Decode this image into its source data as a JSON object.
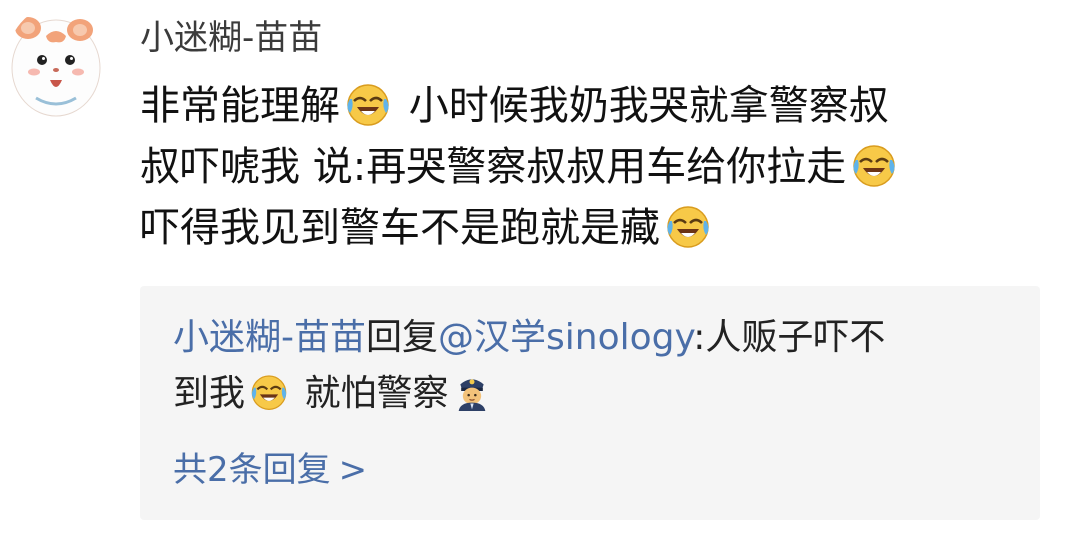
{
  "post": {
    "username": "小迷糊-苗苗",
    "avatar_icon": "hamster-avatar",
    "comment": {
      "line1_a": "非常能理解",
      "line1_b": "小时候我奶我哭就拿警察叔",
      "line2_a": "叔吓唬我 说:再哭警察叔叔用车给你拉走",
      "line3_a": "吓得我见到警车不是跑就是藏"
    },
    "emoji_icon": "laughing-crying-emoji"
  },
  "reply": {
    "author": "小迷糊-苗苗",
    "reply_word": "回复",
    "mention": "@汉学sinology",
    "text_a": ":人贩子吓不",
    "text_b": "到我",
    "text_c": "就怕警察",
    "police_icon": "police-officer-emoji",
    "more_label": "共2条回复",
    "more_chevron": ">"
  },
  "colors": {
    "link": "#4a6ea8",
    "reply_bg": "#f5f5f5"
  }
}
